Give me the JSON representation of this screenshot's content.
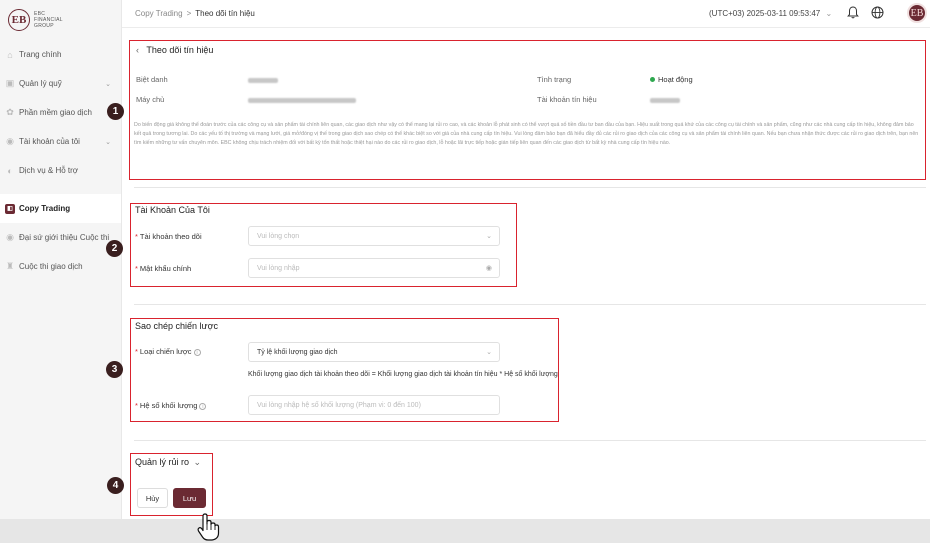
{
  "brand": {
    "logo_letters": "EB",
    "logo_text": "EBC FINANCIAL GROUP"
  },
  "sidebar": {
    "items": [
      {
        "label": "Trang chính",
        "icon": "home-icon",
        "chevron": false,
        "active": false
      },
      {
        "label": "Quản lý quỹ",
        "icon": "wallet-icon",
        "chevron": true,
        "active": false
      },
      {
        "label": "Phần mềm giao dịch",
        "icon": "software-icon",
        "chevron": false,
        "active": false
      },
      {
        "label": "Tài khoản của tôi",
        "icon": "user-icon",
        "chevron": true,
        "active": false
      },
      {
        "label": "Dịch vụ & Hỗ trợ",
        "icon": "support-icon",
        "chevron": false,
        "active": false
      },
      {
        "label": "Copy Trading",
        "icon": "copy-trading-icon",
        "chevron": false,
        "active": true
      },
      {
        "label": "Đại sứ giới thiệu Cuộc thi",
        "icon": "ambassador-icon",
        "chevron": false,
        "active": false
      },
      {
        "label": "Cuộc thi giao dịch",
        "icon": "trophy-icon",
        "chevron": false,
        "active": false
      }
    ]
  },
  "topbar": {
    "breadcrumb_parent": "Copy Trading",
    "breadcrumb_sep": ">",
    "breadcrumb_current": "Theo dõi tín hiệu",
    "timezone": "(UTC+03)  2025-03-11 09:53:47",
    "avatar_letter": "EB"
  },
  "signal": {
    "title": "Theo dõi tín hiệu",
    "nickname_label": "Biệt danh",
    "server_label": "Máy chủ",
    "status_label": "Tình trạng",
    "status_value": "Hoạt động",
    "signal_account_label": "Tài khoản tín hiệu",
    "disclaimer": "Do biến động giá không thể đoán trước của các công cụ và sản phẩm tài chính liên quan, các giao dịch như vậy có thể mang lại rủi ro cao, và các khoản lỗ phát sinh có thể vượt quá số tiền đầu tư ban đầu của bạn. Hiệu suất trong quá khứ của các công cụ tài chính và sản phẩm, cũng như các nhà cung cấp tín hiệu, không đảm bảo kết quả trong tương lai. Do các yếu tố thị trường và mạng lưới, giá mở/đóng vị thế trong giao dịch sao chép có thể khác biệt so với giá của nhà cung cấp tín hiệu. Vui lòng đảm bảo bạn đã hiểu đầy đủ các rủi ro giao dịch của các công cụ và sản phẩm tài chính liên quan. Nếu bạn chưa nhận thức được các rủi ro giao dịch trên, bạn nên tìm kiếm những tư vấn chuyên môn. EBC không chịu trách nhiệm đối với bất kỳ tổn thất hoặc thiệt hại nào do các rủi ro giao dịch, lỗ hoặc lãi trực tiếp hoặc gián tiếp liên quan đến các giao dịch từ bất kỳ nhà cung cấp tín hiệu nào."
  },
  "my_account": {
    "title": "Tài Khoản Của Tôi",
    "follow_account_label": "Tài khoản theo dõi",
    "follow_account_placeholder": "Vui lòng chọn",
    "password_label": "Mật khẩu chính",
    "password_placeholder": "Vui lòng nhập"
  },
  "strategy": {
    "title": "Sao chép chiến lược",
    "type_label": "Loại chiến lược",
    "type_value": "Tỷ lệ khối lượng giao dịch",
    "formula": "Khối lượng giao dịch tài khoản theo dõi = Khối lượng giao dịch tài khoản tín hiệu * Hệ số khối lượng",
    "ratio_label": "Hệ số khối lượng",
    "ratio_placeholder": "Vui lòng nhập hệ số khối lượng (Phạm vi: 0 đến 100)"
  },
  "risk": {
    "title": "Quản lý rủi ro",
    "cancel_label": "Hủy",
    "save_label": "Lưu"
  },
  "badges": [
    "1",
    "2",
    "3",
    "4"
  ],
  "colors": {
    "brand": "#6b2a33",
    "annotation_red": "#d9232e",
    "status_green": "#2ea84f",
    "badge_dark": "#3a1f1f"
  }
}
